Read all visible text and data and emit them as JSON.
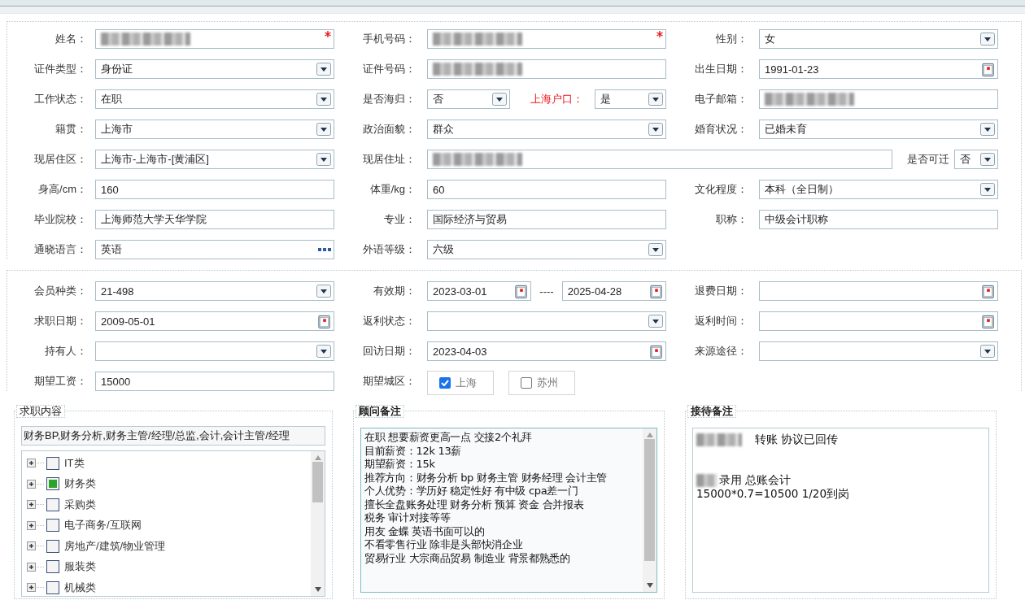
{
  "profile_rows": [
    [
      {
        "label": "姓名：",
        "field": {
          "kind": "text",
          "redacted": true,
          "required": true
        }
      },
      {
        "label": "手机号码：",
        "field": {
          "kind": "text",
          "redacted": true,
          "required": true
        }
      },
      {
        "label": "性别：",
        "field": {
          "kind": "select",
          "value": "女"
        }
      }
    ],
    [
      {
        "label": "证件类型：",
        "field": {
          "kind": "select",
          "value": "身份证"
        }
      },
      {
        "label": "证件号码：",
        "field": {
          "kind": "text",
          "redacted": true
        }
      },
      {
        "label": "出生日期：",
        "field": {
          "kind": "date",
          "value": "1991-01-23"
        }
      }
    ],
    [
      {
        "label": "工作状态：",
        "field": {
          "kind": "select",
          "value": "在职"
        }
      },
      {
        "label": "是否海归：",
        "field": {
          "kind": "select",
          "value": "否"
        },
        "extra": {
          "label": "上海户口：",
          "highlight": true,
          "field": {
            "kind": "select",
            "value": "是"
          }
        }
      },
      {
        "label": "电子邮箱：",
        "field": {
          "kind": "text",
          "redacted": true
        }
      }
    ],
    [
      {
        "label": "籍贯：",
        "field": {
          "kind": "select",
          "value": "上海市"
        }
      },
      {
        "label": "政治面貌：",
        "field": {
          "kind": "select",
          "value": "群众"
        }
      },
      {
        "label": "婚育状况：",
        "field": {
          "kind": "select",
          "value": "已婚未育"
        }
      }
    ],
    [
      {
        "label": "现居住区：",
        "field": {
          "kind": "select",
          "value": "上海市-上海市-[黄浦区]"
        }
      },
      {
        "label": "现居住址：",
        "wide": true,
        "field": {
          "kind": "text",
          "redacted": true
        },
        "extra": {
          "label": "是否可迁",
          "highlight": false,
          "field": {
            "kind": "select",
            "value": "否"
          }
        }
      }
    ],
    [
      {
        "label": "身高/cm：",
        "field": {
          "kind": "text",
          "value": "160"
        }
      },
      {
        "label": "体重/kg：",
        "field": {
          "kind": "text",
          "value": "60"
        }
      },
      {
        "label": "文化程度：",
        "field": {
          "kind": "select",
          "value": "本科（全日制）"
        }
      }
    ],
    [
      {
        "label": "毕业院校：",
        "field": {
          "kind": "text",
          "value": "上海师范大学天华学院"
        }
      },
      {
        "label": "专业：",
        "field": {
          "kind": "text",
          "value": "国际经济与贸易"
        }
      },
      {
        "label": "职称：",
        "field": {
          "kind": "text",
          "value": "中级会计职称"
        }
      }
    ],
    [
      {
        "label": "通晓语言：",
        "field": {
          "kind": "picker",
          "value": "英语"
        }
      },
      {
        "label": "外语等级：",
        "field": {
          "kind": "select",
          "value": "六级"
        }
      }
    ]
  ],
  "membership_rows": [
    [
      {
        "label": "会员种类：",
        "field": {
          "kind": "select",
          "value": "21-498"
        }
      },
      {
        "label": "有效期：",
        "field": {
          "kind": "date_range",
          "values": [
            "2023-03-01",
            "2025-04-28"
          ],
          "separator": "----"
        }
      },
      {
        "label": "退费日期：",
        "field": {
          "kind": "date"
        }
      }
    ],
    [
      {
        "label": "求职日期：",
        "field": {
          "kind": "date",
          "value": "2009-05-01"
        }
      },
      {
        "label": "返利状态：",
        "field": {
          "kind": "select"
        }
      },
      {
        "label": "返利时间：",
        "field": {
          "kind": "date"
        }
      }
    ],
    [
      {
        "label": "持有人：",
        "field": {
          "kind": "select"
        }
      },
      {
        "label": "回访日期：",
        "field": {
          "kind": "date",
          "value": "2023-04-03"
        }
      },
      {
        "label": "来源途径：",
        "field": {
          "kind": "select"
        }
      }
    ],
    [
      {
        "label": "期望工资：",
        "field": {
          "kind": "text",
          "value": "15000"
        }
      },
      {
        "label": "期望城区：",
        "field": {
          "kind": "checkbox_group",
          "options": [
            {
              "label": "上海",
              "checked": true
            },
            {
              "label": "苏州",
              "checked": false
            }
          ]
        }
      }
    ]
  ],
  "job_content": {
    "title": "求职内容",
    "summary": "财务BP,财务分析,财务主管/经理/总监,会计,会计主管/经理",
    "categories": [
      {
        "label": "IT类",
        "checked": false,
        "expanded": false
      },
      {
        "label": "财务类",
        "checked": true,
        "expanded": false
      },
      {
        "label": "采购类",
        "checked": false,
        "expanded": false
      },
      {
        "label": "电子商务/互联网",
        "checked": false,
        "expanded": false
      },
      {
        "label": "房地产/建筑/物业管理",
        "checked": false,
        "expanded": false
      },
      {
        "label": "服装类",
        "checked": false,
        "expanded": false
      },
      {
        "label": "机械类",
        "checked": false,
        "expanded": false
      }
    ]
  },
  "advisor_notes": {
    "title": "顾问备注",
    "lines": [
      "在职 想要薪资更高一点 交接2个礼拜",
      "目前薪资：12k 13薪",
      "期望薪资：15k",
      "推荐方向：财务分析 bp 财务主管 财务经理  会计主管",
      "个人优势：学历好 稳定性好 有中级 cpa差一门",
      "擅长全盘账务处理 财务分析 预算 资金 合并报表",
      "税务 审计对接等等",
      "用友 金蝶 英语书面可以的",
      "不看零售行业 除非是头部快消企业",
      "贸易行业 大宗商品贸易 制造业 背景都熟悉的"
    ]
  },
  "reception_notes": {
    "title": "接待备注",
    "lines": [
      {
        "redacted_prefix": true,
        "text": "转账 协议已回传",
        "blank_before": false
      },
      {
        "redacted_prefix": true,
        "text": "录用 总账会计",
        "blank_before": true
      },
      {
        "redacted_prefix": false,
        "text": "15000*0.7=10500  1/20到岗",
        "blank_before": false
      }
    ]
  }
}
